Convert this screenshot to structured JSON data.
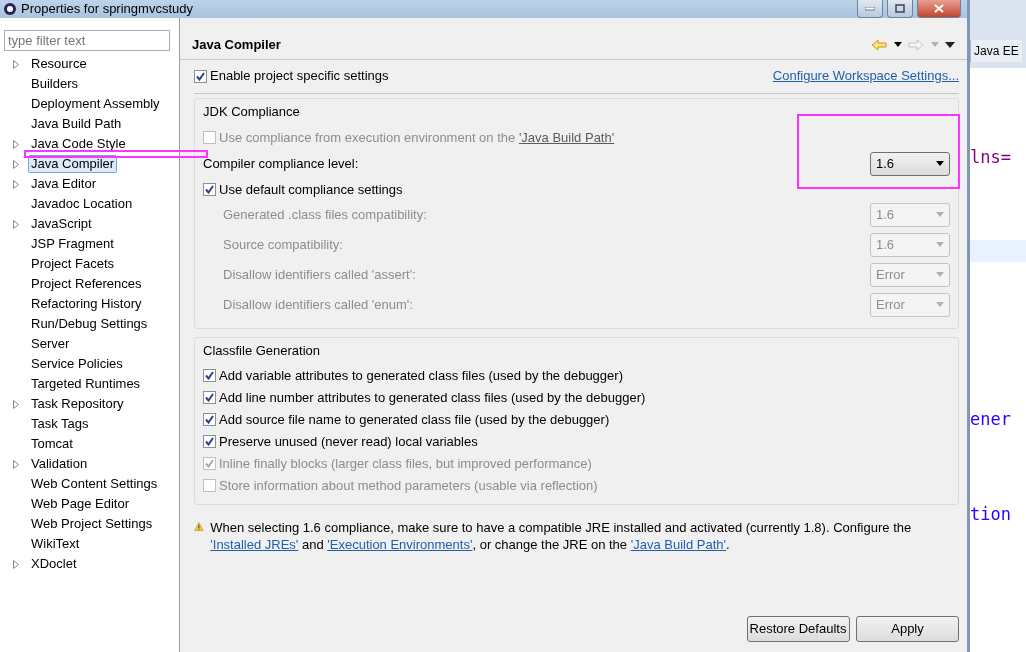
{
  "window": {
    "title": "Properties for springmvcstudy"
  },
  "filter": {
    "placeholder": "type filter text"
  },
  "tree": [
    {
      "label": "Resource",
      "expandable": true,
      "selected": false
    },
    {
      "label": "Builders",
      "expandable": false,
      "selected": false
    },
    {
      "label": "Deployment Assembly",
      "expandable": false,
      "selected": false
    },
    {
      "label": "Java Build Path",
      "expandable": false,
      "selected": false
    },
    {
      "label": "Java Code Style",
      "expandable": true,
      "selected": false
    },
    {
      "label": "Java Compiler",
      "expandable": true,
      "selected": true
    },
    {
      "label": "Java Editor",
      "expandable": true,
      "selected": false
    },
    {
      "label": "Javadoc Location",
      "expandable": false,
      "selected": false
    },
    {
      "label": "JavaScript",
      "expandable": true,
      "selected": false
    },
    {
      "label": "JSP Fragment",
      "expandable": false,
      "selected": false
    },
    {
      "label": "Project Facets",
      "expandable": false,
      "selected": false
    },
    {
      "label": "Project References",
      "expandable": false,
      "selected": false
    },
    {
      "label": "Refactoring History",
      "expandable": false,
      "selected": false
    },
    {
      "label": "Run/Debug Settings",
      "expandable": false,
      "selected": false
    },
    {
      "label": "Server",
      "expandable": false,
      "selected": false
    },
    {
      "label": "Service Policies",
      "expandable": false,
      "selected": false
    },
    {
      "label": "Targeted Runtimes",
      "expandable": false,
      "selected": false
    },
    {
      "label": "Task Repository",
      "expandable": true,
      "selected": false
    },
    {
      "label": "Task Tags",
      "expandable": false,
      "selected": false
    },
    {
      "label": "Tomcat",
      "expandable": false,
      "selected": false
    },
    {
      "label": "Validation",
      "expandable": true,
      "selected": false
    },
    {
      "label": "Web Content Settings",
      "expandable": false,
      "selected": false
    },
    {
      "label": "Web Page Editor",
      "expandable": false,
      "selected": false
    },
    {
      "label": "Web Project Settings",
      "expandable": false,
      "selected": false
    },
    {
      "label": "WikiText",
      "expandable": false,
      "selected": false
    },
    {
      "label": "XDoclet",
      "expandable": true,
      "selected": false
    }
  ],
  "page": {
    "title": "Java Compiler"
  },
  "enable_project_settings": {
    "label": "Enable project specific settings",
    "checked": true
  },
  "workspace_link": "Configure Workspace Settings...",
  "jdk_compliance": {
    "title": "JDK Compliance",
    "use_ee": {
      "label": "Use compliance from execution environment on the ",
      "link": "'Java Build Path'",
      "checked": false,
      "disabled": true
    },
    "level": {
      "label": "Compiler compliance level:",
      "value": "1.6"
    },
    "use_default": {
      "label": "Use default compliance settings",
      "checked": true,
      "disabled": false
    },
    "settings": [
      {
        "label": "Generated .class files compatibility:",
        "value": "1.6",
        "disabled": true
      },
      {
        "label": "Source compatibility:",
        "value": "1.6",
        "disabled": true
      },
      {
        "label": "Disallow identifiers called 'assert':",
        "value": "Error",
        "disabled": true
      },
      {
        "label": "Disallow identifiers called 'enum':",
        "value": "Error",
        "disabled": true
      }
    ]
  },
  "classfile": {
    "title": "Classfile Generation",
    "options": [
      {
        "label": "Add variable attributes to generated class files (used by the debugger)",
        "checked": true,
        "disabled": false
      },
      {
        "label": "Add line number attributes to generated class files (used by the debugger)",
        "checked": true,
        "disabled": false
      },
      {
        "label": "Add source file name to generated class file (used by the debugger)",
        "checked": true,
        "disabled": false
      },
      {
        "label": "Preserve unused (never read) local variables",
        "checked": true,
        "disabled": false
      },
      {
        "label": "Inline finally blocks (larger class files, but improved performance)",
        "checked": true,
        "disabled": true
      },
      {
        "label": "Store information about method parameters (usable via reflection)",
        "checked": false,
        "disabled": true
      }
    ]
  },
  "warning": {
    "parts": [
      {
        "kind": "text",
        "text": "When selecting 1.6 compliance, make sure to have a compatible JRE installed and activated (currently 1.8). Configure the "
      },
      {
        "kind": "link",
        "text": "'Installed JREs'"
      },
      {
        "kind": "text",
        "text": " and "
      },
      {
        "kind": "link",
        "text": "'Execution Environments'"
      },
      {
        "kind": "text",
        "text": ", or change the JRE on the "
      },
      {
        "kind": "link",
        "text": "'Java Build Path'"
      },
      {
        "kind": "text",
        "text": "."
      }
    ]
  },
  "buttons": [
    {
      "label": "Restore Defaults"
    },
    {
      "label": "Apply"
    }
  ],
  "editor": {
    "tab": "Java EE",
    "fragments": [
      {
        "kind": "attribute",
        "text": "lns="
      },
      {
        "kind": "value",
        "text": "ener"
      },
      {
        "kind": "value",
        "text": "tion"
      }
    ]
  },
  "annotations": {
    "tree_item_mark": true,
    "compliance_mark": true
  }
}
